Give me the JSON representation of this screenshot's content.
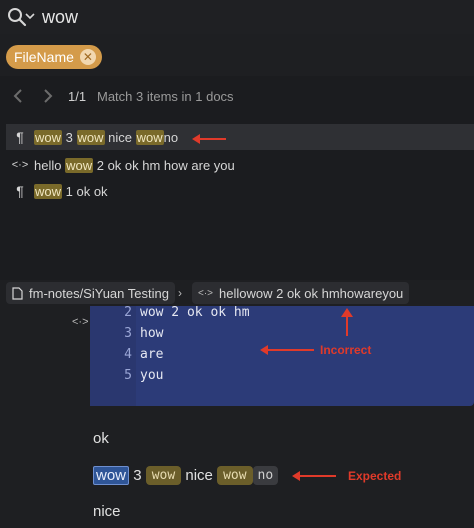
{
  "search": {
    "query": "wow"
  },
  "filter": {
    "chip_label": "FileName"
  },
  "results": {
    "pager": "1/1",
    "match_text": "Match 3 items in 1 docs",
    "rows": [
      {
        "icon": "paragraph-icon",
        "parts": [
          "wow",
          "3",
          "wow",
          "nice",
          "wow",
          "no"
        ]
      },
      {
        "icon": "embed-icon",
        "pre": "hello",
        "hl": "wow",
        "post": "2 ok ok hm how are you"
      },
      {
        "icon": "paragraph-icon",
        "hl": "wow",
        "post": "1 ok ok"
      }
    ]
  },
  "breadcrumb": {
    "doc": "fm-notes/SiYuan Testing",
    "block": "hellowow 2 ok ok hmhowareyou"
  },
  "code": {
    "lines": [
      {
        "n": "2",
        "text": "wow 2 ok ok hm"
      },
      {
        "n": "3",
        "text": "how"
      },
      {
        "n": "4",
        "text": "are"
      },
      {
        "n": "5",
        "text": "you"
      }
    ]
  },
  "editor": {
    "ok": "ok",
    "expected_parts": [
      "wow",
      "3",
      "wow",
      "nice",
      "wow",
      "no"
    ],
    "nice": "nice"
  },
  "annotations": {
    "incorrect": "Incorrect",
    "expected": "Expected",
    "color": "#e03a2a"
  }
}
